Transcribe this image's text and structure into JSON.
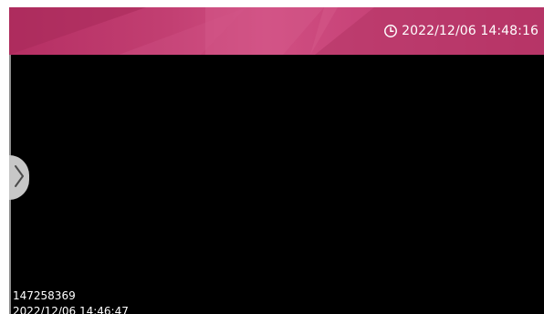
{
  "header": {
    "clock_icon": "clock-icon",
    "datetime": "2022/12/06 14:48:16",
    "colors": {
      "primary": "#c23f72",
      "text": "#ffffff"
    }
  },
  "video": {
    "background": "#000000",
    "expand_icon": "chevron-right-icon",
    "overlay": {
      "id": "147258369",
      "timestamp": "2022/12/06 14:46:47"
    }
  }
}
